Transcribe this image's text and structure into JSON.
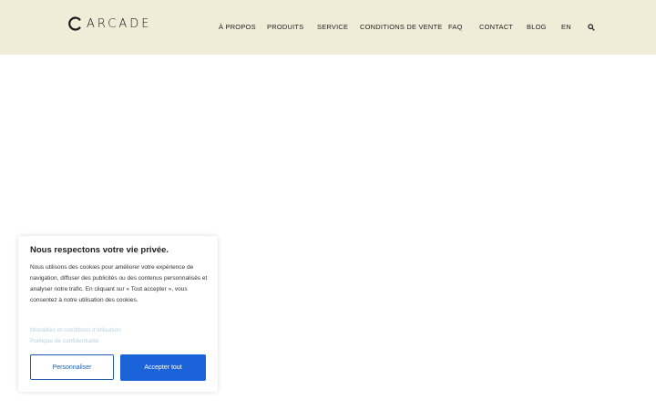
{
  "header": {
    "logo_text": "ARCADE",
    "background": "#efecd8",
    "nav": [
      {
        "label": "À PROPOS"
      },
      {
        "label": "PRODUITS"
      },
      {
        "label": "SERVICE"
      },
      {
        "label": "CONDITIONS DE VENTE"
      },
      {
        "label": "FAQ"
      },
      {
        "label": "CONTACT"
      },
      {
        "label": "BLOG"
      },
      {
        "label": "EN"
      }
    ],
    "search_icon": "search-icon"
  },
  "cookie": {
    "title": "Nous respectons votre vie privée.",
    "body": "Nous utilisons des cookies pour améliorer votre expérience de navigation, diffuser des publicités ou des contenus personnalisés et analyser notre trafic. En cliquant sur « Tout accepter », vous consentez à notre utilisation des cookies.",
    "link_terms": "Modalités et conditions d'utilisation",
    "link_privacy": "Politique de confidentialité",
    "customize_label": "Personnaliser",
    "accept_label": "Accepter tout",
    "accent": "#1a63d8"
  }
}
